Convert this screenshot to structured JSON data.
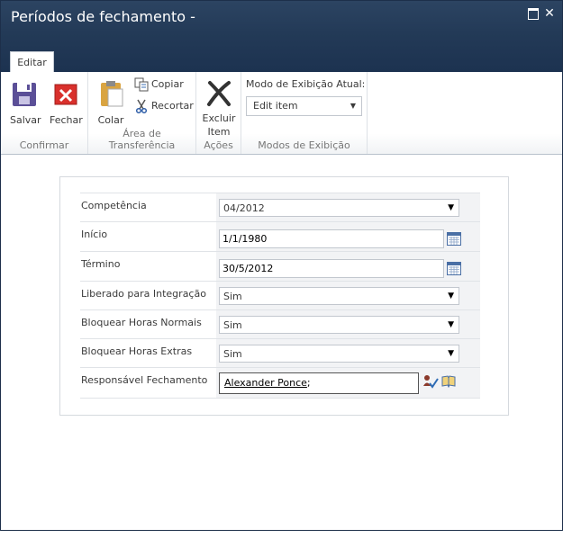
{
  "window": {
    "title": "Períodos de fechamento -",
    "maximize_icon": "maximize-icon",
    "close_label": "✕"
  },
  "ribbon": {
    "tab": "Editar",
    "groups": {
      "confirm": {
        "label": "Confirmar",
        "save": "Salvar",
        "close": "Fechar"
      },
      "clipboard": {
        "label": "Área de Transferência",
        "paste": "Colar",
        "copy": "Copiar",
        "cut": "Recortar"
      },
      "actions": {
        "label": "Ações",
        "delete_line1": "Excluir",
        "delete_line2": "Item"
      },
      "views": {
        "label": "Modos de Exibição",
        "current_label": "Modo de Exibição Atual:",
        "current_value": "Edit item"
      }
    }
  },
  "form": {
    "fields": [
      {
        "label": "Competência",
        "type": "select",
        "value": "04/2012"
      },
      {
        "label": "Início",
        "type": "date",
        "value": "1/1/1980"
      },
      {
        "label": "Término",
        "type": "date",
        "value": "30/5/2012"
      },
      {
        "label": "Liberado para Integração",
        "type": "select",
        "value": "Sim"
      },
      {
        "label": "Bloquear Horas Normais",
        "type": "select",
        "value": "Sim"
      },
      {
        "label": "Bloquear Horas Extras",
        "type": "select",
        "value": "Sim"
      },
      {
        "label": "Responsável Fechamento",
        "type": "people",
        "value": "Alexander Ponce",
        "suffix": ";"
      }
    ]
  },
  "colors": {
    "titlebar": "#233a57",
    "accent_red": "#d9302c",
    "save_purple": "#5b4f97"
  }
}
